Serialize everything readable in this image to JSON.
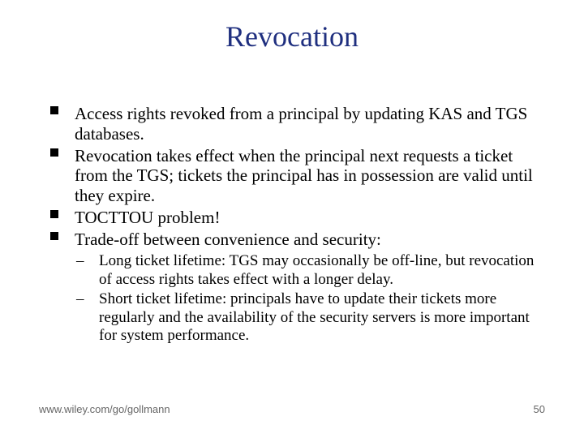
{
  "title": "Revocation",
  "bullets": [
    "Access rights revoked from a principal by updating KAS and TGS databases.",
    "Revocation takes effect when the principal next requests a ticket from the TGS; tickets the principal has in possession are valid until they expire.",
    "TOCTTOU problem!",
    "Trade-off between convenience and security:"
  ],
  "subbullets": [
    "Long ticket lifetime: TGS may occasionally be off-line, but revocation of access rights takes effect with a longer delay.",
    "Short ticket lifetime: principals have to update their tickets more regularly and the availability of the security servers is more important for system performance."
  ],
  "footer_left": "www.wiley.com/go/gollmann",
  "footer_right": "50"
}
